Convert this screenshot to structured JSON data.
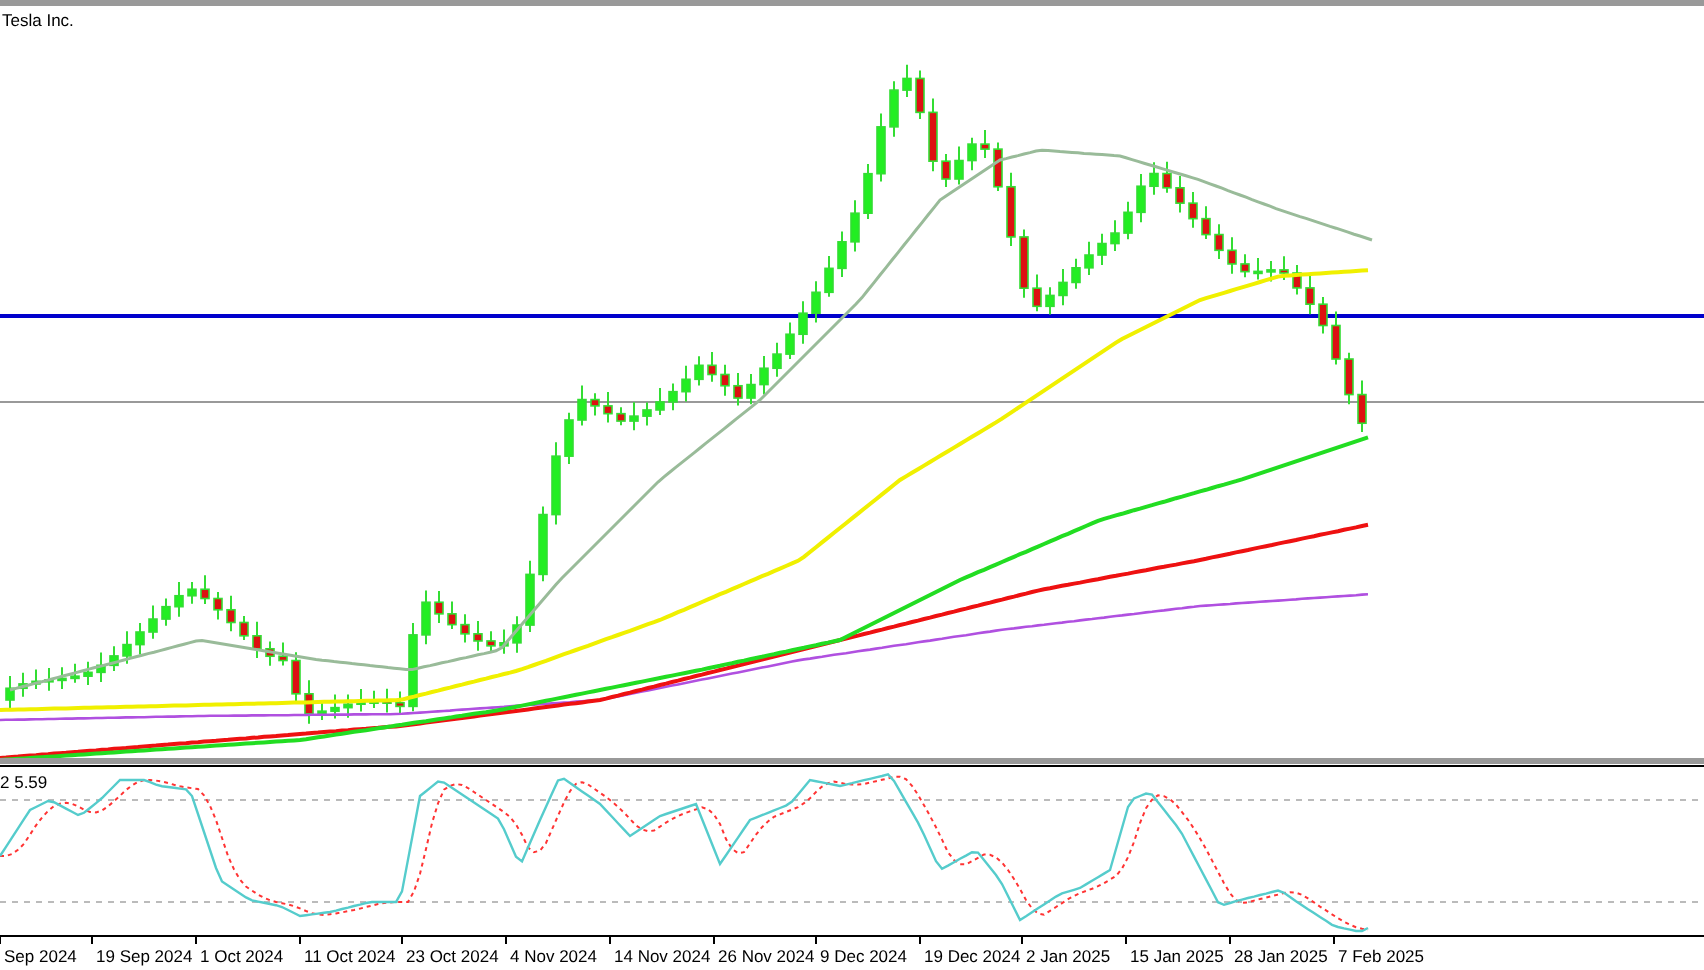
{
  "chart": {
    "title": "Tesla Inc."
  },
  "oscillator": {
    "label": "2 5.59"
  },
  "time_axis": {
    "labels": [
      "Sep 2024",
      "19 Sep 2024",
      "1 Oct 2024",
      "11 Oct 2024",
      "23 Oct 2024",
      "4 Nov 2024",
      "14 Nov 2024",
      "26 Nov 2024",
      "9 Dec 2024",
      "19 Dec 2024",
      "2 Jan 2025",
      "15 Jan 2025",
      "28 Jan 2025",
      "7 Feb 2025"
    ]
  }
}
